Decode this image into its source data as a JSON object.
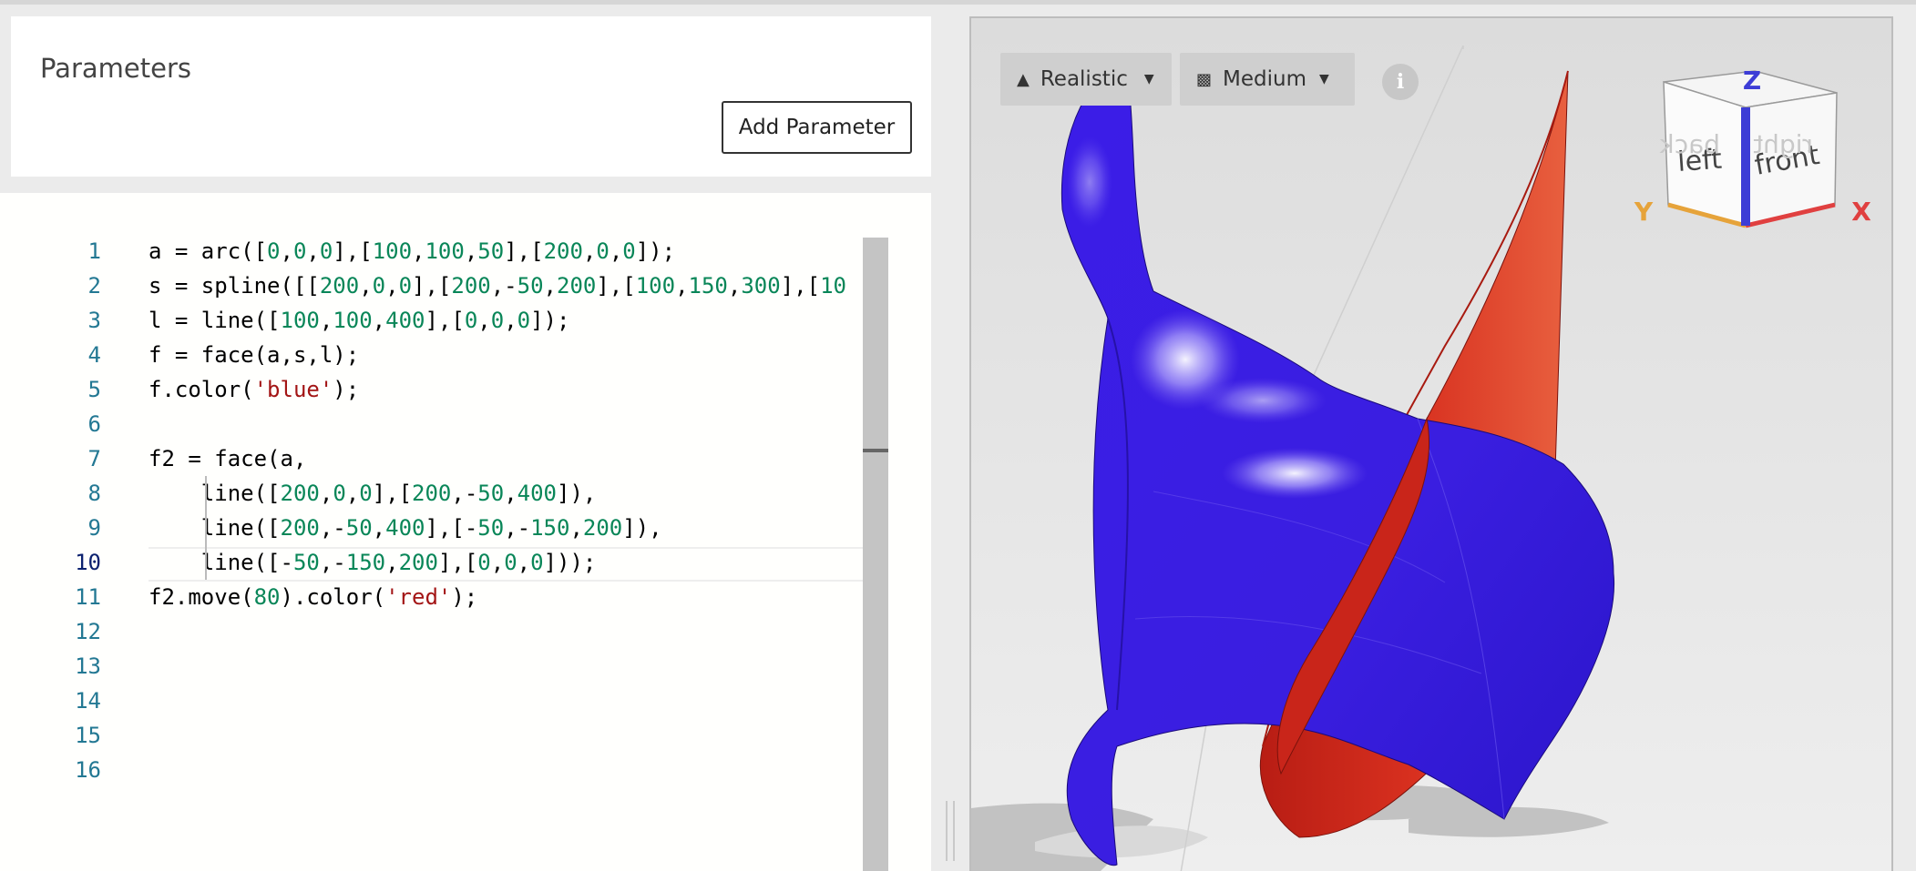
{
  "parameters": {
    "title": "Parameters",
    "add_button": "Add Parameter"
  },
  "editor": {
    "active_line": 10,
    "lines": [
      {
        "num": "1",
        "tokens": [
          [
            "p",
            "a = arc(["
          ],
          [
            "n",
            "0"
          ],
          [
            "p",
            ","
          ],
          [
            "n",
            "0"
          ],
          [
            "p",
            ","
          ],
          [
            "n",
            "0"
          ],
          [
            "p",
            "],["
          ],
          [
            "n",
            "100"
          ],
          [
            "p",
            ","
          ],
          [
            "n",
            "100"
          ],
          [
            "p",
            ","
          ],
          [
            "n",
            "50"
          ],
          [
            "p",
            "],["
          ],
          [
            "n",
            "200"
          ],
          [
            "p",
            ","
          ],
          [
            "n",
            "0"
          ],
          [
            "p",
            ","
          ],
          [
            "n",
            "0"
          ],
          [
            "p",
            "]);"
          ]
        ]
      },
      {
        "num": "2",
        "tokens": [
          [
            "p",
            "s = spline([["
          ],
          [
            "n",
            "200"
          ],
          [
            "p",
            ","
          ],
          [
            "n",
            "0"
          ],
          [
            "p",
            ","
          ],
          [
            "n",
            "0"
          ],
          [
            "p",
            "],["
          ],
          [
            "n",
            "200"
          ],
          [
            "p",
            ",-"
          ],
          [
            "n",
            "50"
          ],
          [
            "p",
            ","
          ],
          [
            "n",
            "200"
          ],
          [
            "p",
            "],["
          ],
          [
            "n",
            "100"
          ],
          [
            "p",
            ","
          ],
          [
            "n",
            "150"
          ],
          [
            "p",
            ","
          ],
          [
            "n",
            "300"
          ],
          [
            "p",
            "],["
          ],
          [
            "n",
            "10"
          ]
        ]
      },
      {
        "num": "3",
        "tokens": [
          [
            "p",
            "l = line(["
          ],
          [
            "n",
            "100"
          ],
          [
            "p",
            ","
          ],
          [
            "n",
            "100"
          ],
          [
            "p",
            ","
          ],
          [
            "n",
            "400"
          ],
          [
            "p",
            "],["
          ],
          [
            "n",
            "0"
          ],
          [
            "p",
            ","
          ],
          [
            "n",
            "0"
          ],
          [
            "p",
            ","
          ],
          [
            "n",
            "0"
          ],
          [
            "p",
            "]);"
          ]
        ]
      },
      {
        "num": "4",
        "tokens": [
          [
            "p",
            "f = face(a,s,l);"
          ]
        ]
      },
      {
        "num": "5",
        "tokens": [
          [
            "p",
            "f.color("
          ],
          [
            "s",
            "'blue'"
          ],
          [
            "p",
            ");"
          ]
        ]
      },
      {
        "num": "6",
        "tokens": []
      },
      {
        "num": "7",
        "tokens": [
          [
            "p",
            "f2 = face(a,"
          ]
        ]
      },
      {
        "num": "8",
        "tokens": [
          [
            "p",
            "    line(["
          ],
          [
            "n",
            "200"
          ],
          [
            "p",
            ","
          ],
          [
            "n",
            "0"
          ],
          [
            "p",
            ","
          ],
          [
            "n",
            "0"
          ],
          [
            "p",
            "],["
          ],
          [
            "n",
            "200"
          ],
          [
            "p",
            ",-"
          ],
          [
            "n",
            "50"
          ],
          [
            "p",
            ","
          ],
          [
            "n",
            "400"
          ],
          [
            "p",
            "]),"
          ]
        ]
      },
      {
        "num": "9",
        "tokens": [
          [
            "p",
            "    line(["
          ],
          [
            "n",
            "200"
          ],
          [
            "p",
            ",-"
          ],
          [
            "n",
            "50"
          ],
          [
            "p",
            ","
          ],
          [
            "n",
            "400"
          ],
          [
            "p",
            "],[-"
          ],
          [
            "n",
            "50"
          ],
          [
            "p",
            ",-"
          ],
          [
            "n",
            "150"
          ],
          [
            "p",
            ","
          ],
          [
            "n",
            "200"
          ],
          [
            "p",
            "]),"
          ]
        ]
      },
      {
        "num": "10",
        "tokens": [
          [
            "p",
            "    line([-"
          ],
          [
            "n",
            "50"
          ],
          [
            "p",
            ",-"
          ],
          [
            "n",
            "150"
          ],
          [
            "p",
            ","
          ],
          [
            "n",
            "200"
          ],
          [
            "p",
            "],["
          ],
          [
            "n",
            "0"
          ],
          [
            "p",
            ","
          ],
          [
            "n",
            "0"
          ],
          [
            "p",
            ","
          ],
          [
            "n",
            "0"
          ],
          [
            "p",
            "]));"
          ]
        ]
      },
      {
        "num": "11",
        "tokens": [
          [
            "p",
            "f2.move("
          ],
          [
            "n",
            "80"
          ],
          [
            "p",
            ").color("
          ],
          [
            "s",
            "'red'"
          ],
          [
            "p",
            ");"
          ]
        ]
      },
      {
        "num": "12",
        "tokens": []
      },
      {
        "num": "13",
        "tokens": []
      },
      {
        "num": "14",
        "tokens": []
      },
      {
        "num": "15",
        "tokens": []
      },
      {
        "num": "16",
        "tokens": []
      }
    ]
  },
  "viewer": {
    "render_mode": "Realistic",
    "quality": "Medium",
    "info_glyph": "i",
    "nav_cube": {
      "faces": [
        "left",
        "front",
        "back",
        "right"
      ],
      "axes": [
        "X",
        "Y",
        "Z"
      ],
      "axis_colors": {
        "x": "#e04040",
        "y": "#e8a33a",
        "z": "#3d3dd6"
      }
    },
    "shape_colors": {
      "blue": "#3a1ee0",
      "red": "#d42b1e"
    },
    "icons": [
      "mountain-icon",
      "quality-icon",
      "caret-down-icon",
      "info-icon"
    ]
  }
}
